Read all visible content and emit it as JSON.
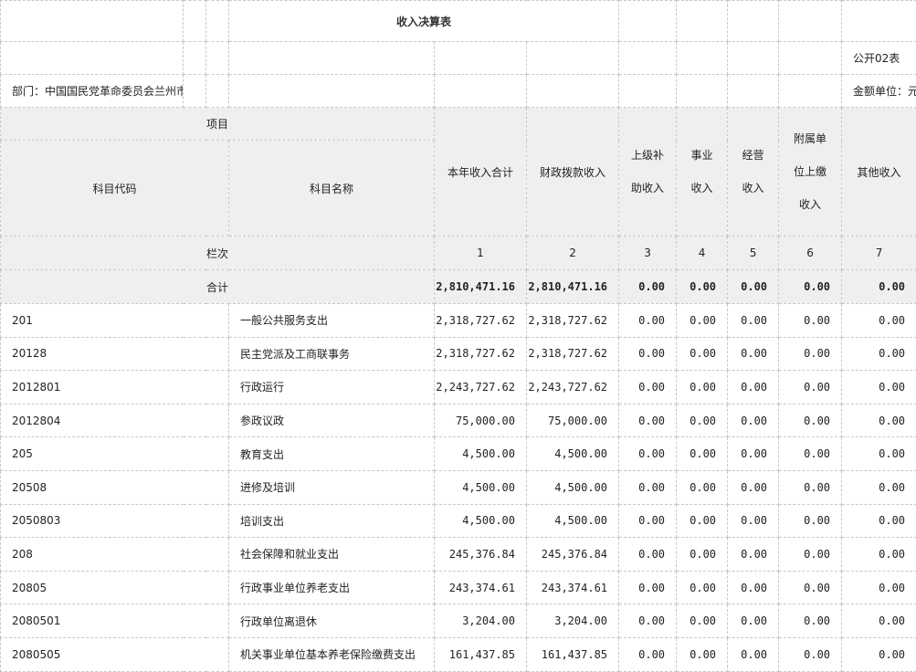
{
  "title": "收入决算表",
  "form_code": "公开02表",
  "department": "部门：中国国民党革命委员会兰州市委员会",
  "unit": "金额单位：元",
  "headers": {
    "item": "项目",
    "code": "科目代码",
    "name": "科目名称",
    "total": "本年收入合计",
    "fiscal": "财政拨款收入",
    "superior_line1": "上级补",
    "superior_line2": "助收入",
    "business_line1": "事业",
    "business_line2": "收入",
    "operating_line1": "经营",
    "operating_line2": "收入",
    "affiliated_line1": "附属单",
    "affiliated_line2": "位上缴",
    "affiliated_line3": "收入",
    "other": "其他收入",
    "column_no": "栏次",
    "col_nums": [
      "1",
      "2",
      "3",
      "4",
      "5",
      "6",
      "7"
    ]
  },
  "total_row": {
    "label": "合计",
    "values": [
      "2,810,471.16",
      "2,810,471.16",
      "0.00",
      "0.00",
      "0.00",
      "0.00",
      "0.00"
    ]
  },
  "rows": [
    {
      "code": "201",
      "name": "一般公共服务支出",
      "values": [
        "2,318,727.62",
        "2,318,727.62",
        "0.00",
        "0.00",
        "0.00",
        "0.00",
        "0.00"
      ]
    },
    {
      "code": "20128",
      "name": "民主党派及工商联事务",
      "values": [
        "2,318,727.62",
        "2,318,727.62",
        "0.00",
        "0.00",
        "0.00",
        "0.00",
        "0.00"
      ]
    },
    {
      "code": "2012801",
      "name": "行政运行",
      "values": [
        "2,243,727.62",
        "2,243,727.62",
        "0.00",
        "0.00",
        "0.00",
        "0.00",
        "0.00"
      ]
    },
    {
      "code": "2012804",
      "name": "参政议政",
      "values": [
        "75,000.00",
        "75,000.00",
        "0.00",
        "0.00",
        "0.00",
        "0.00",
        "0.00"
      ]
    },
    {
      "code": "205",
      "name": "教育支出",
      "values": [
        "4,500.00",
        "4,500.00",
        "0.00",
        "0.00",
        "0.00",
        "0.00",
        "0.00"
      ]
    },
    {
      "code": "20508",
      "name": "进修及培训",
      "values": [
        "4,500.00",
        "4,500.00",
        "0.00",
        "0.00",
        "0.00",
        "0.00",
        "0.00"
      ]
    },
    {
      "code": "2050803",
      "name": "培训支出",
      "values": [
        "4,500.00",
        "4,500.00",
        "0.00",
        "0.00",
        "0.00",
        "0.00",
        "0.00"
      ]
    },
    {
      "code": "208",
      "name": "社会保障和就业支出",
      "values": [
        "245,376.84",
        "245,376.84",
        "0.00",
        "0.00",
        "0.00",
        "0.00",
        "0.00"
      ]
    },
    {
      "code": "20805",
      "name": "行政事业单位养老支出",
      "values": [
        "243,374.61",
        "243,374.61",
        "0.00",
        "0.00",
        "0.00",
        "0.00",
        "0.00"
      ]
    },
    {
      "code": "2080501",
      "name": "行政单位离退休",
      "values": [
        "3,204.00",
        "3,204.00",
        "0.00",
        "0.00",
        "0.00",
        "0.00",
        "0.00"
      ]
    },
    {
      "code": "2080505",
      "name": "机关事业单位基本养老保险缴费支出",
      "values": [
        "161,437.85",
        "161,437.85",
        "0.00",
        "0.00",
        "0.00",
        "0.00",
        "0.00"
      ]
    }
  ]
}
